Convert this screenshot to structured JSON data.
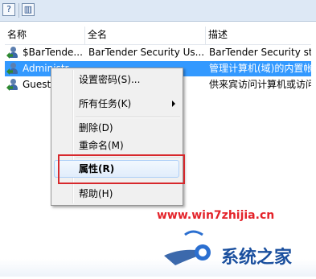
{
  "toolbar": {
    "buttons": [
      {
        "label": "?"
      },
      {
        "label": "▥"
      }
    ]
  },
  "columns": [
    "名称",
    "全名",
    "描述"
  ],
  "rows": [
    {
      "name": "$BarTende...",
      "fullname": "BarTender Security Us...",
      "desc": "BarTender Security sta",
      "selected": false
    },
    {
      "name": "Administr...",
      "fullname": "",
      "desc": "管理计算机(域)的内置帐",
      "selected": true
    },
    {
      "name": "Guest",
      "fullname": "",
      "desc": "供来宾访问计算机或访问",
      "selected": false
    }
  ],
  "context_menu": {
    "items": [
      {
        "label": "设置密码(S)..."
      },
      {
        "label": "所有任务(K)",
        "submenu": true
      },
      {
        "label": "删除(D)"
      },
      {
        "label": "重命名(M)"
      },
      {
        "label": "属性(R)",
        "bold": true,
        "highlighted": true
      },
      {
        "label": "帮助(H)"
      }
    ]
  },
  "watermark": {
    "url": "www.win7zhijia.cn",
    "brand": "系统之家",
    "color": "#e4232a"
  }
}
